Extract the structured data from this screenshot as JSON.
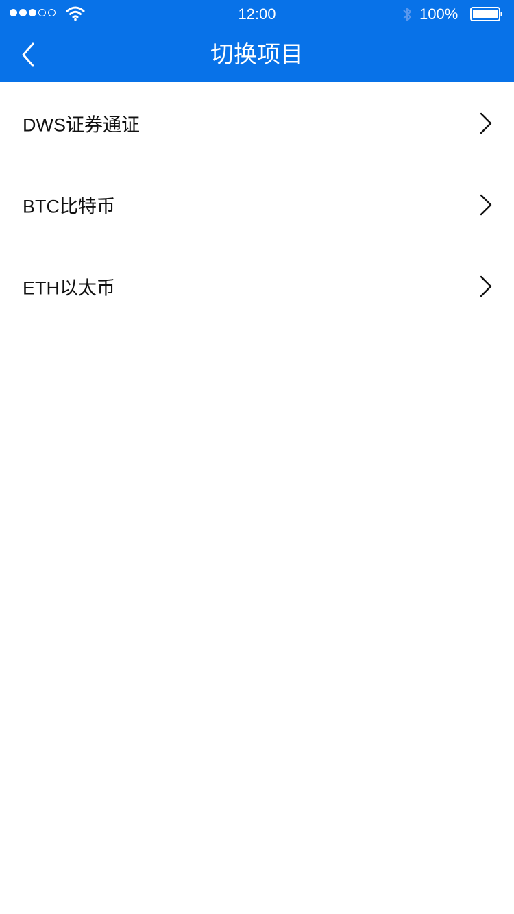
{
  "status_bar": {
    "time": "12:00",
    "battery": "100%",
    "signal_icon": "signal-dots-icon",
    "wifi_icon": "wifi-icon",
    "bluetooth_icon": "bluetooth-icon",
    "battery_icon": "battery-icon"
  },
  "nav": {
    "title": "切换项目",
    "back_icon": "chevron-left-icon"
  },
  "list": {
    "items": [
      {
        "label": "DWS证券通证",
        "icon": "chevron-right-icon"
      },
      {
        "label": "BTC比特币",
        "icon": "chevron-right-icon"
      },
      {
        "label": "ETH以太币",
        "icon": "chevron-right-icon"
      }
    ]
  },
  "colors": {
    "header_bg": "#0872e8",
    "header_text": "#ffffff",
    "background": "#ffffff",
    "item_text": "#111111"
  }
}
